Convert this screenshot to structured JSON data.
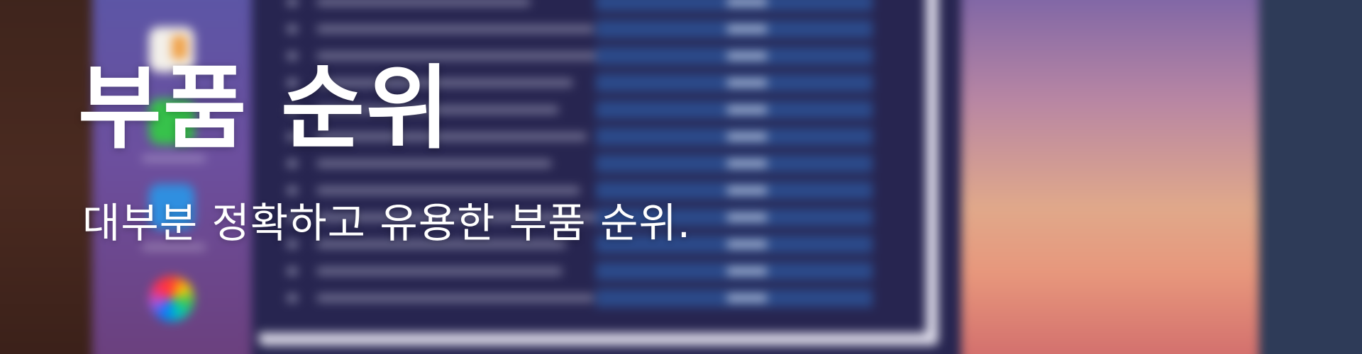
{
  "hero": {
    "title": "부품 순위",
    "subtitle": "대부분 정확하고 유용한 부품 순위."
  },
  "background": {
    "description_only_visual": false,
    "colors": {
      "window": "#272550",
      "dock": "#5b56a6",
      "table_bar": "#2b4a8a",
      "sunset_top": "#7a63a6",
      "sunset_bottom": "#d06a6b"
    },
    "dock_icons": [
      "document-icon",
      "app-green-icon",
      "app-blue-icon",
      "color-wheel-icon"
    ]
  }
}
